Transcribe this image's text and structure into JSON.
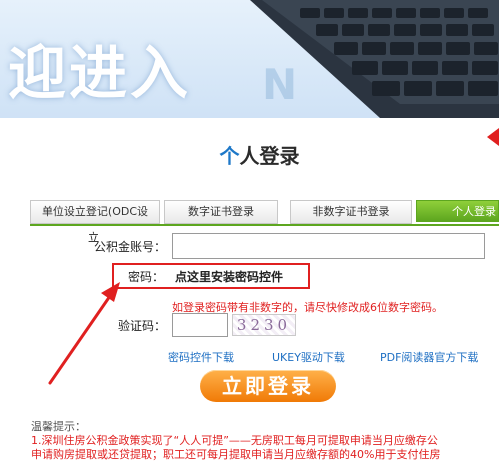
{
  "banner": {
    "title": "迎进入",
    "faded_letter": "N"
  },
  "login_title": {
    "prefix": "个",
    "rest": "人登录"
  },
  "tabs": [
    {
      "label": "单位设立登记(ODC设"
    },
    {
      "label": "数字证书登录"
    },
    {
      "label": "非数字证书登录"
    },
    {
      "label": "个人登录"
    }
  ],
  "form": {
    "account_label": "公积金账号：",
    "account_label_overlay": "立",
    "account_value": "",
    "password_label": "密码：",
    "password_link": "点这里安装密码控件",
    "password_note": "如登录密码带有非数字的，请尽快修改成6位数字密码。",
    "captcha_label": "验证码：",
    "captcha_value": "",
    "captcha_image_text": "3230"
  },
  "downloads": [
    {
      "label": "密码控件下载"
    },
    {
      "label": "UKEY驱动下载"
    },
    {
      "label": "PDF阅读器官方下载"
    }
  ],
  "login_button": "立即登录",
  "tips": {
    "title": "温馨提示：",
    "line1": "1.深圳住房公积金政策实现了“人人可提”——无房职工每月可提取申请当月应缴存公",
    "line2": "申请购房提取或还贷提取；职工还可每月提取申请当月应缴存额的40%用于支付住房"
  },
  "colors": {
    "accent_red": "#e02020",
    "tab_active": "#5da61f",
    "button_orange": "#f07a06",
    "link_blue": "#1e6fc3"
  }
}
